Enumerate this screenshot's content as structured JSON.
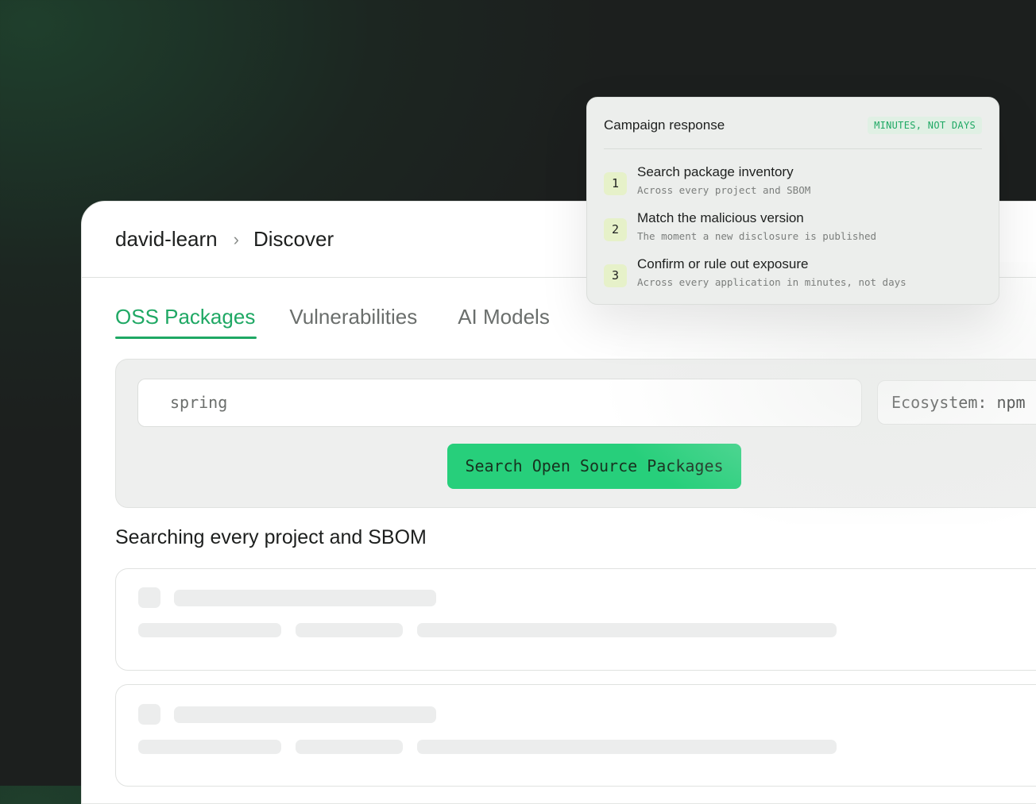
{
  "breadcrumb": {
    "org": "david-learn",
    "separator": "›",
    "page": "Discover"
  },
  "tabs": [
    {
      "label": "OSS Packages",
      "active": true
    },
    {
      "label": "Vulnerabilities",
      "active": false
    },
    {
      "label": "AI Models",
      "active": false
    }
  ],
  "search": {
    "value": "spring",
    "ecosystem_label": "Ecosystem: npm",
    "button_label": "Search Open Source Packages"
  },
  "results": {
    "title": "Searching every project and SBOM"
  },
  "campaign": {
    "title": "Campaign response",
    "badge": "MINUTES, NOT DAYS",
    "steps": [
      {
        "number": "1",
        "title": "Search package inventory",
        "subtitle": "Across every project and SBOM"
      },
      {
        "number": "2",
        "title": "Match the malicious version",
        "subtitle": "The moment a new disclosure is published"
      },
      {
        "number": "3",
        "title": "Confirm or rule out exposure",
        "subtitle": "Across every application in minutes, not days"
      }
    ]
  },
  "colors": {
    "accent": "#1fa864",
    "button": "#27cf7b",
    "background_dark": "#1c1f1e"
  }
}
